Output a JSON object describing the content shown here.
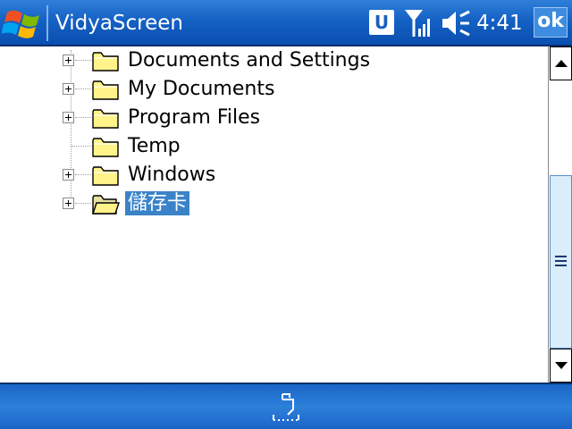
{
  "titlebar": {
    "app_title": "VidyaScreen",
    "status_letter": "U",
    "clock": "4:41",
    "ok_label": "ok"
  },
  "tree": {
    "items": [
      {
        "label": "Documents and Settings",
        "expandable": true,
        "selected": false
      },
      {
        "label": "My Documents",
        "expandable": true,
        "selected": false
      },
      {
        "label": "Program Files",
        "expandable": true,
        "selected": false
      },
      {
        "label": "Temp",
        "expandable": false,
        "selected": false
      },
      {
        "label": "Windows",
        "expandable": true,
        "selected": false
      },
      {
        "label": "儲存卡",
        "expandable": true,
        "selected": true
      }
    ]
  },
  "icons": {
    "start": "windows-flag-icon",
    "signal": "antenna-signal-icon",
    "volume": "speaker-muted-icon",
    "folder": "folder-icon",
    "storage_card": "storage-card-folder-icon",
    "keyboard": "input-panel-icon"
  },
  "colors": {
    "titlebar": "#1561c4",
    "selection": "#3b83c8",
    "folder_fill": "#fff38a",
    "scroll_thumb": "#d9edfb"
  }
}
